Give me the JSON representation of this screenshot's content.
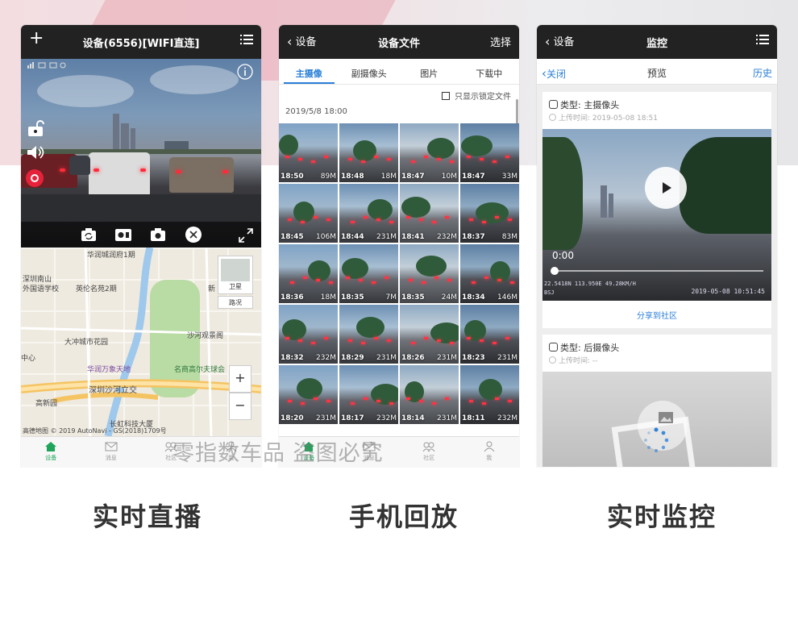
{
  "watermark": "零指数车品 盗图必究",
  "captions": [
    "实时直播",
    "手机回放",
    "实时监控"
  ],
  "tabbar": [
    "设备",
    "消息",
    "社区",
    "我"
  ],
  "live": {
    "title": "设备(6556)[WIFI直连]",
    "map_labels": [
      "华润城润府1期",
      "深圳南山",
      "外国语学校",
      "英伦名苑2期",
      "大冲城市花园",
      "沙河观景阁",
      "中心",
      "华润万象天地",
      "名商高尔夫球会",
      "深圳沙河立交",
      "高新园",
      "长虹科技大厦",
      "新"
    ],
    "map_layers": [
      "卫星",
      "路况"
    ],
    "map_copyright": "高德地图 © 2019 AutoNavi - GS(2018)1709号",
    "zoom_in": "+",
    "zoom_out": "−"
  },
  "files": {
    "back": "设备",
    "title": "设备文件",
    "right": "选择",
    "tabs": [
      "主摄像",
      "副摄像头",
      "图片",
      "下载中"
    ],
    "lock_filter": "只显示锁定文件",
    "date": "2019/5/8 18:00",
    "thumbs": [
      {
        "time": "18:50",
        "size": "89M"
      },
      {
        "time": "18:48",
        "size": "18M"
      },
      {
        "time": "18:47",
        "size": "10M"
      },
      {
        "time": "18:47",
        "size": "33M"
      },
      {
        "time": "18:45",
        "size": "106M"
      },
      {
        "time": "18:44",
        "size": "231M"
      },
      {
        "time": "18:41",
        "size": "232M"
      },
      {
        "time": "18:37",
        "size": "83M"
      },
      {
        "time": "18:36",
        "size": "18M"
      },
      {
        "time": "18:35",
        "size": "7M"
      },
      {
        "time": "18:35",
        "size": "24M"
      },
      {
        "time": "18:34",
        "size": "146M"
      },
      {
        "time": "18:32",
        "size": "232M"
      },
      {
        "time": "18:29",
        "size": "231M"
      },
      {
        "time": "18:26",
        "size": "231M"
      },
      {
        "time": "18:23",
        "size": "231M"
      },
      {
        "time": "18:20",
        "size": "231M"
      },
      {
        "time": "18:17",
        "size": "232M"
      },
      {
        "time": "18:14",
        "size": "231M"
      },
      {
        "time": "18:11",
        "size": "232M"
      }
    ]
  },
  "monitor": {
    "back": "设备",
    "title": "监控",
    "close": "关闭",
    "preview": "预览",
    "history": "历史",
    "card1": {
      "type": "类型: 主摄像头",
      "time": "上传时间: 2019-05-08 18:51",
      "elapsed": "0:00",
      "overlay_left": "22.5418N  113.950E  49.28KM/H",
      "overlay_sub": "BSJ",
      "overlay_right": "2019-05-08 10:51:45",
      "share": "分享到社区"
    },
    "card2": {
      "type": "类型: 后摄像头",
      "time": "上传时间: --"
    }
  }
}
